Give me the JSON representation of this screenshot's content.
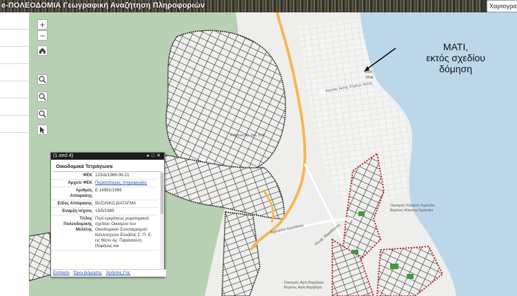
{
  "header": {
    "title": "e-ΠΟΛΕΟΔΟΜΙΑ Γεωγραφική Αναζήτηση Πληροφοριών",
    "right_box": "Χαρτογραφ"
  },
  "annotation": {
    "line1": "ΜΑΤΙ,",
    "line2": "εκτός σχεδίου",
    "line3": "δόμηση"
  },
  "map_controls": {
    "zoom_in": "+",
    "zoom_out": "−"
  },
  "map_labels": {
    "mati": "Μάτι",
    "mati2": "Mati",
    "coastal_road": "Κόστας Ακτής Κτιρίων Ακτής",
    "school_upper": "Οικισμός Κόκκινο Λιμανάκι",
    "school_upper2": "Βερίνος Κόκκινο Λιμανάκι",
    "school_lower": "Οικισμός Αγία Βαρβάρα",
    "school_lower2": "Βερίνος Αγία Βαρβάρα",
    "road_argyrous": "Αργυρίου Αργαθείας",
    "road_tmp": "Λεωφ. Μαραθώνος",
    "village_center": "Ράφηνα Αγ. Νικ. Ν.Ρ."
  },
  "popup": {
    "counter": "(1 από 4)",
    "title": "Οικοδομικά Τετράγωνα",
    "rows": [
      {
        "key": "ΦΕΚ",
        "value": "123/Δ/1969-06-21"
      },
      {
        "key": "Αρχείο ΦΕΚ",
        "value": "Περισσότερες πληροφορίες",
        "link": true
      },
      {
        "key": "Αριθμός Απόφασης",
        "value": "Ε.14991/1969"
      },
      {
        "key": "Είδος Απόφασης",
        "value": "ΒΑΣΙΛΙΚΟ ΔΙΑΤΑΓΜΑ"
      },
      {
        "key": "Έναρξη Ισχύος",
        "value": "15/5/1969"
      },
      {
        "key": "Τίτλος Πολεοδομικής Μελέτης",
        "value": "Περί εγκρίσεως ρυμοτομικού σχεδίου Οικισμού του Οικοδομικού Συνεταιρισμού Καλλιτεχνών Ελλάδος Σ. Π. Ε. εις θέσιν Αγ. Παρασκευή Ραφήνας και"
      }
    ],
    "footer": {
      "zoom": "Εστίαση",
      "terms": "Όροι Δόμησης",
      "uses": "Χρήσεις Γης"
    }
  },
  "colors": {
    "sea": "#bcd7ea",
    "land": "#eeeeec",
    "green": "#b5ceb0",
    "road_major": "#f6b652",
    "plan_outline": "#222222",
    "old_plan": "#b22222"
  }
}
